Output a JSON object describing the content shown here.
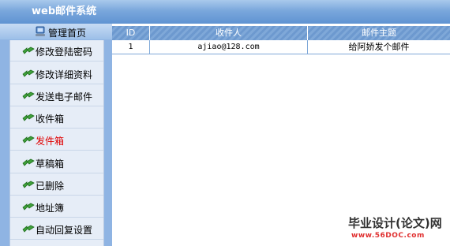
{
  "app": {
    "title": "web邮件系统"
  },
  "sidebar": {
    "home_label": "管理首页",
    "items": [
      {
        "label": "修改登陆密码"
      },
      {
        "label": "修改详细资料"
      },
      {
        "label": "发送电子邮件"
      },
      {
        "label": "收件箱"
      },
      {
        "label": "发件箱",
        "active": true
      },
      {
        "label": "草稿箱"
      },
      {
        "label": "已删除"
      },
      {
        "label": "地址簿"
      },
      {
        "label": "自动回复设置"
      }
    ]
  },
  "table": {
    "headers": [
      "ID",
      "收件人",
      "邮件主题"
    ],
    "rows": [
      {
        "id": "1",
        "recipient": "ajiao@128.com",
        "subject": "给阿娇发个邮件"
      }
    ]
  },
  "watermark": {
    "text": "毕业设计(论文)网",
    "url": "www.56DOC.com"
  },
  "colors": {
    "active_menu": "#e00000",
    "header_blue": "#6d99cf"
  }
}
